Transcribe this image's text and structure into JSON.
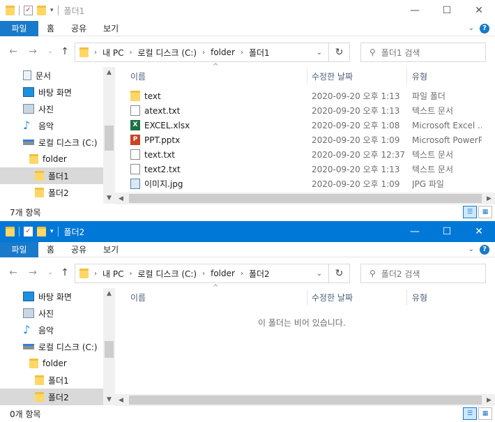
{
  "window1": {
    "title": "폴더1",
    "ribbon": {
      "file": "파일",
      "tabs": [
        "홈",
        "공유",
        "보기"
      ]
    },
    "address": {
      "crumbs": [
        "내 PC",
        "로컬 디스크 (C:)",
        "folder",
        "폴더1"
      ]
    },
    "search_placeholder": "폴더1 검색",
    "tree": [
      "문서",
      "바탕 화면",
      "사진",
      "음악",
      "로컬 디스크 (C:)",
      "folder",
      "폴더1",
      "폴더2"
    ],
    "columns": {
      "name": "이름",
      "date": "수정한 날짜",
      "type": "유형"
    },
    "files": [
      {
        "name": "text",
        "date": "2020-09-20 오후 1:13",
        "type": "파일 폴더",
        "icon": "folder-icon"
      },
      {
        "name": "atext.txt",
        "date": "2020-09-20 오후 1:13",
        "type": "텍스트 문서",
        "icon": "text-file-icon"
      },
      {
        "name": "EXCEL.xlsx",
        "date": "2020-09-20 오후 1:08",
        "type": "Microsoft Excel ...",
        "icon": "excel-file-icon"
      },
      {
        "name": "PPT.pptx",
        "date": "2020-09-20 오후 1:09",
        "type": "Microsoft PowerP...",
        "icon": "powerpoint-file-icon"
      },
      {
        "name": "text.txt",
        "date": "2020-09-20 오후 12:37",
        "type": "텍스트 문서",
        "icon": "text-file-icon"
      },
      {
        "name": "text2.txt",
        "date": "2020-09-20 오후 1:13",
        "type": "텍스트 문서",
        "icon": "text-file-icon"
      },
      {
        "name": "이미지.jpg",
        "date": "2020-09-20 오후 1:09",
        "type": "JPG 파일",
        "icon": "image-file-icon"
      }
    ],
    "status": "7개 항목"
  },
  "window2": {
    "title": "폴더2",
    "ribbon": {
      "file": "파일",
      "tabs": [
        "홈",
        "공유",
        "보기"
      ]
    },
    "address": {
      "crumbs": [
        "내 PC",
        "로컬 디스크 (C:)",
        "folder",
        "폴더2"
      ]
    },
    "search_placeholder": "폴더2 검색",
    "tree": [
      "바탕 화면",
      "사진",
      "음악",
      "로컬 디스크 (C:)",
      "folder",
      "폴더1",
      "폴더2"
    ],
    "columns": {
      "name": "이름",
      "date": "수정한 날짜",
      "type": "유형"
    },
    "empty_message": "이 폴더는 비어 있습니다.",
    "status": "0개 항목"
  },
  "colors": {
    "accent": "#0078d7",
    "file_tab": "#1979ca",
    "folder": "#ffd766",
    "selection": "#d9d9d9"
  }
}
